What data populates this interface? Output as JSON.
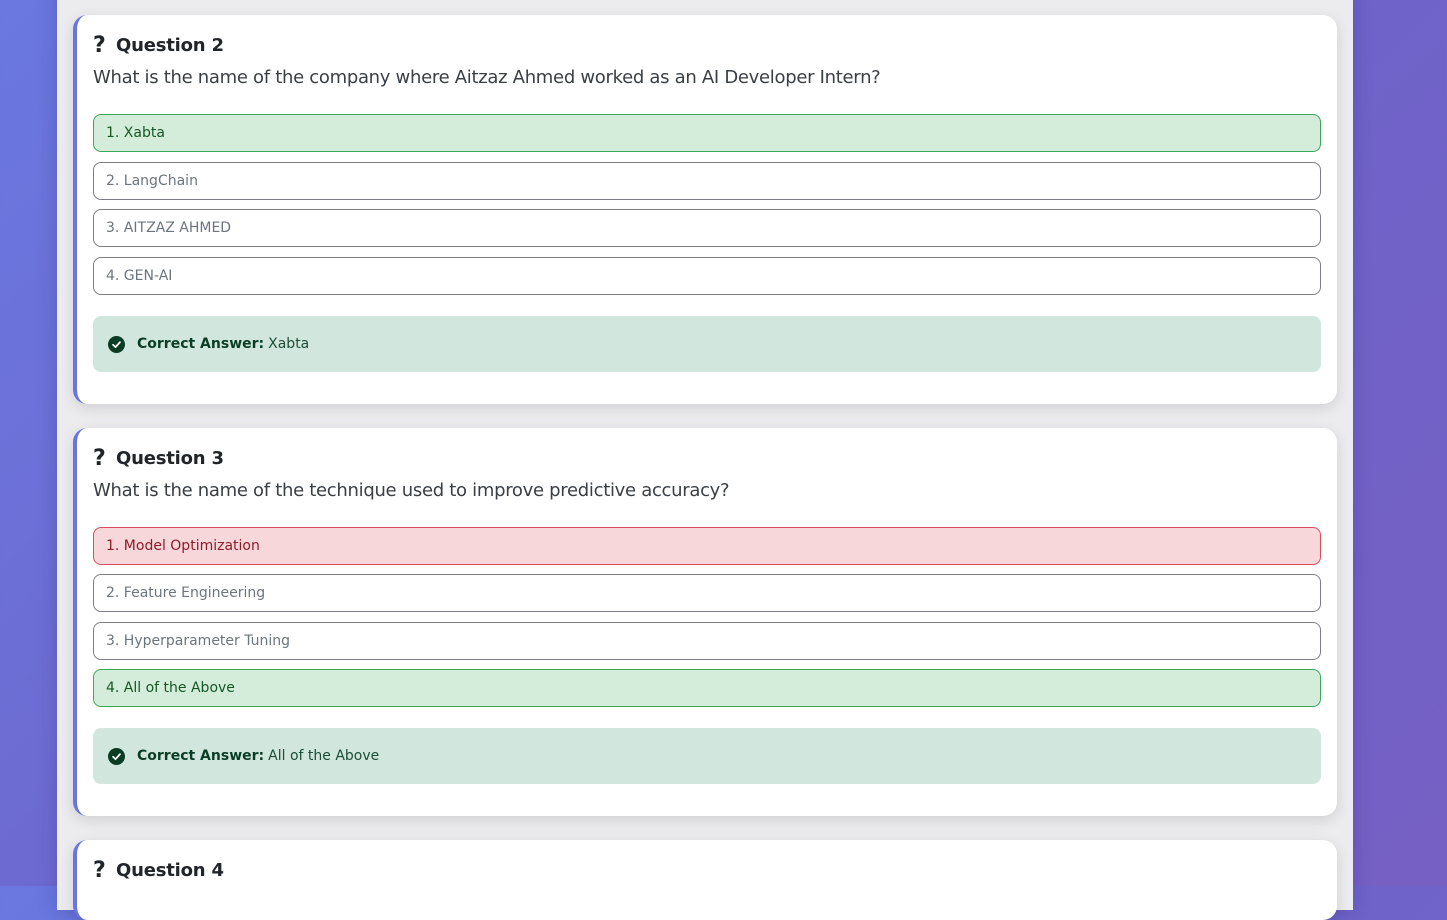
{
  "questions": [
    {
      "title": "Question 2",
      "text": "What is the name of the company where Aitzaz Ahmed worked as an AI Developer Intern?",
      "options": [
        "1. Xabta",
        "2. LangChain",
        "3. AITZAZ AHMED",
        "4. GEN-AI"
      ],
      "option_states": [
        "correct",
        "neutral",
        "neutral",
        "neutral"
      ],
      "answer_label": "Correct Answer:",
      "answer_value": "Xabta"
    },
    {
      "title": "Question 3",
      "text": "What is the name of the technique used to improve predictive accuracy?",
      "options": [
        "1. Model Optimization",
        "2. Feature Engineering",
        "3. Hyperparameter Tuning",
        "4. All of the Above"
      ],
      "option_states": [
        "wrong",
        "neutral",
        "neutral",
        "correct"
      ],
      "answer_label": "Correct Answer:",
      "answer_value": "All of the Above"
    },
    {
      "title": "Question 4"
    }
  ],
  "icons": {
    "question": "question-mark-icon",
    "correct": "check-circle-icon"
  },
  "colors": {
    "background": "#6a78e0",
    "card_accent": "#6874df",
    "correct_bg": "#d4edda",
    "correct_border": "#3aa85b",
    "wrong_bg": "#f8d7da",
    "wrong_border": "#dc4c5c",
    "answer_bg": "#d1e7dd"
  }
}
